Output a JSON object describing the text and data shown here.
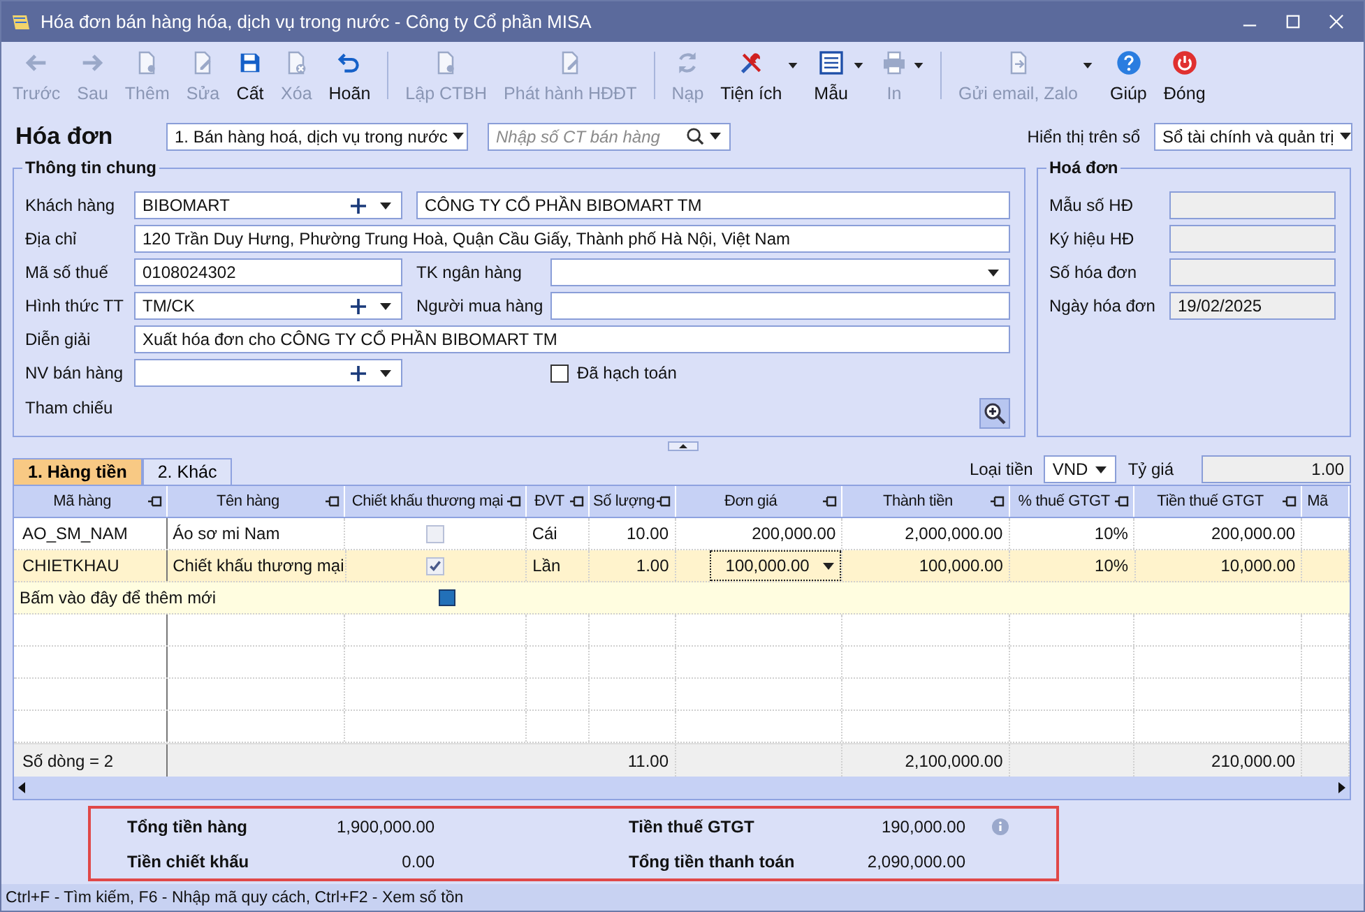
{
  "window": {
    "title": "Hóa đơn bán hàng hóa, dịch vụ trong nước - Công ty Cổ phần MISA"
  },
  "toolbar": {
    "groups": [
      [
        {
          "label": "Trước",
          "disabled": true,
          "has_menu": false
        },
        {
          "label": "Sau",
          "disabled": true,
          "has_menu": false
        },
        {
          "label": "Thêm",
          "disabled": true,
          "has_menu": false
        },
        {
          "label": "Sửa",
          "disabled": true,
          "has_menu": false
        },
        {
          "label": "Cất",
          "disabled": false,
          "has_menu": false
        },
        {
          "label": "Xóa",
          "disabled": true,
          "has_menu": false
        },
        {
          "label": "Hoãn",
          "disabled": false,
          "has_menu": false
        }
      ],
      [
        {
          "label": "Lập CTBH",
          "disabled": true,
          "has_menu": false
        },
        {
          "label": "Phát hành HĐĐT",
          "disabled": true,
          "has_menu": false
        }
      ],
      [
        {
          "label": "Nạp",
          "disabled": true,
          "has_menu": false
        },
        {
          "label": "Tiện ích",
          "disabled": false,
          "has_menu": true
        },
        {
          "label": "Mẫu",
          "disabled": false,
          "has_menu": true
        },
        {
          "label": "In",
          "disabled": true,
          "has_menu": true
        }
      ],
      [
        {
          "label": "Gửi email, Zalo",
          "disabled": true,
          "has_menu": true
        },
        {
          "label": "Giúp",
          "disabled": false,
          "has_menu": false
        },
        {
          "label": "Đóng",
          "disabled": false,
          "has_menu": false
        }
      ]
    ]
  },
  "header": {
    "title": "Hóa đơn",
    "type_select": "1. Bán hàng hoá, dịch vụ trong nước",
    "search": {
      "placeholder": "Nhập số CT bán hàng"
    },
    "display_label": "Hiển thị trên sổ",
    "display_select": "Sổ tài chính và quản trị"
  },
  "general": {
    "title": "Thông tin chung",
    "customer": {
      "label": "Khách hàng",
      "code": "BIBOMART",
      "name": "CÔNG TY CỔ PHẦN BIBOMART TM"
    },
    "address": {
      "label": "Địa chỉ",
      "value": "120 Trần Duy Hưng, Phường Trung Hoà, Quận Cầu Giấy, Thành phố Hà Nội, Việt Nam"
    },
    "tax_code": {
      "label": "Mã số thuế",
      "value": "0108024302"
    },
    "bank_account": {
      "label": "TK ngân hàng"
    },
    "payment": {
      "label": "Hình thức TT",
      "value": "TM/CK"
    },
    "buyer": {
      "label": "Người mua hàng"
    },
    "description": {
      "label": "Diễn giải",
      "value": "Xuất hóa đơn cho CÔNG TY CỔ PHẦN BIBOMART TM"
    },
    "sales_staff": {
      "label": "NV bán hàng"
    },
    "posted": {
      "label": "Đã hạch toán",
      "checked": false
    },
    "reference": {
      "label": "Tham chiếu"
    }
  },
  "invoice": {
    "title": "Hoá đơn",
    "fields": [
      {
        "label": "Mẫu số HĐ"
      },
      {
        "label": "Ký hiệu HĐ"
      },
      {
        "label": "Số hóa đơn"
      },
      {
        "label": "Ngày hóa đơn",
        "value": "19/02/2025"
      }
    ]
  },
  "tabs": [
    {
      "label": "1. Hàng tiền",
      "selected": true
    },
    {
      "label": "2. Khác",
      "selected": false
    }
  ],
  "currency": {
    "label": "Loại tiền",
    "value": "VND",
    "rate_label": "Tỷ giá",
    "rate": "1.00"
  },
  "table": {
    "columns": [
      "Mã hàng",
      "Tên hàng",
      "Chiết khấu thương mại",
      "ĐVT",
      "Số lượng",
      "Đơn giá",
      "Thành tiền",
      "% thuế GTGT",
      "Tiền thuế GTGT",
      "Mã"
    ],
    "rows": [
      {
        "code": "AO_SM_NAM",
        "name": "Áo sơ mi Nam",
        "discount": false,
        "unit": "Cái",
        "quantity": "10.00",
        "unit_price": "200,000.00",
        "amount": "2,000,000.00",
        "vat_rate": "10%",
        "vat_amount": "200,000.00",
        "selected": false
      },
      {
        "code": "CHIETKHAU",
        "name": "Chiết khấu thương mại",
        "discount": true,
        "unit": "Lần",
        "quantity": "1.00",
        "unit_price": "100,000.00",
        "amount": "100,000.00",
        "vat_rate": "10%",
        "vat_amount": "10,000.00",
        "selected": true
      }
    ],
    "new_row_hint": "Bấm vào đây để thêm mới",
    "footer": {
      "label": "Số dòng = 2",
      "quantity": "11.00",
      "amount": "2,100,000.00",
      "vat_amount": "210,000.00"
    }
  },
  "summary": [
    {
      "label": "Tổng tiền hàng",
      "value": "1,900,000.00"
    },
    {
      "label": "Tiền thuế GTGT",
      "value": "190,000.00"
    },
    {
      "label": "Tiền chiết khấu",
      "value": "0.00"
    },
    {
      "label": "Tổng tiền thanh toán",
      "value": "2,090,000.00"
    }
  ],
  "status_bar": "Ctrl+F - Tìm kiếm, F6 - Nhập mã quy cách, Ctrl+F2 - Xem số tồn"
}
